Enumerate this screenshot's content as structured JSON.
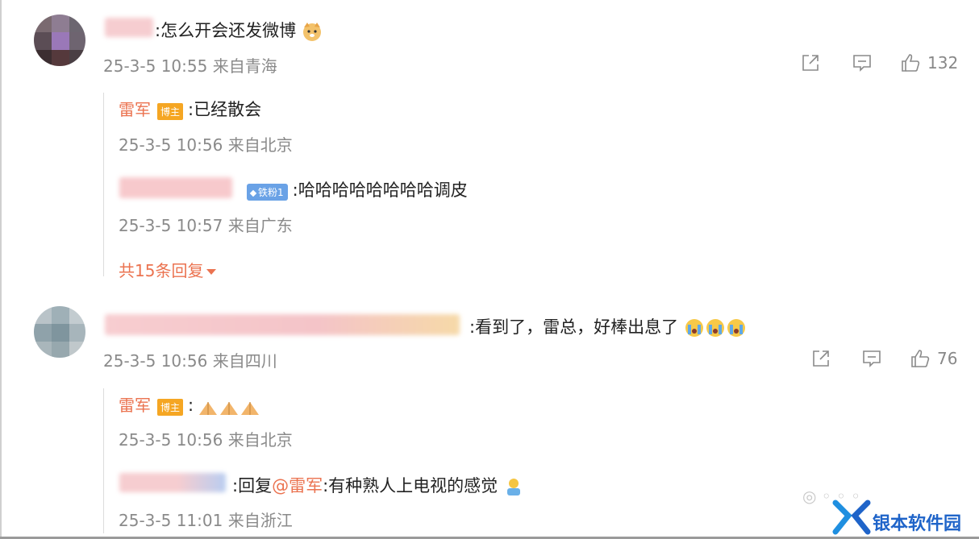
{
  "comments": [
    {
      "text": ":怎么开会还发微博",
      "meta": {
        "date": "25-3-5",
        "time": "10:55",
        "location": "来自青海"
      },
      "likes": "132",
      "replies": [
        {
          "author": "雷军",
          "badge": "博主",
          "text": ":已经散会",
          "meta": {
            "date": "25-3-5",
            "time": "10:56",
            "location": "来自北京"
          }
        },
        {
          "badge": "铁粉1",
          "text": ":哈哈哈哈哈哈哈哈调皮",
          "meta": {
            "date": "25-3-5",
            "time": "10:57",
            "location": "来自广东"
          }
        }
      ],
      "more_replies": "共15条回复"
    },
    {
      "text": ":看到了，雷总，好棒出息了",
      "meta": {
        "date": "25-3-5",
        "time": "10:56",
        "location": "来自四川"
      },
      "likes": "76",
      "replies": [
        {
          "author": "雷军",
          "badge": "博主",
          "text": ":",
          "meta": {
            "date": "25-3-5",
            "time": "10:56",
            "location": "来自北京"
          }
        },
        {
          "prefix": ":回复",
          "mention": "@雷军",
          "text": ":有种熟人上电视的感觉",
          "meta": {
            "date": "25-3-5",
            "time": "11:01",
            "location": "来自浙江"
          }
        }
      ]
    }
  ],
  "watermark": {
    "text": "银本软件园"
  },
  "colors": {
    "name": "#eb7350",
    "meta": "#8a8a8a",
    "watermark": "#1f64c9"
  },
  "icons": [
    "share-icon",
    "comment-icon",
    "like-icon",
    "caret-down-icon"
  ]
}
